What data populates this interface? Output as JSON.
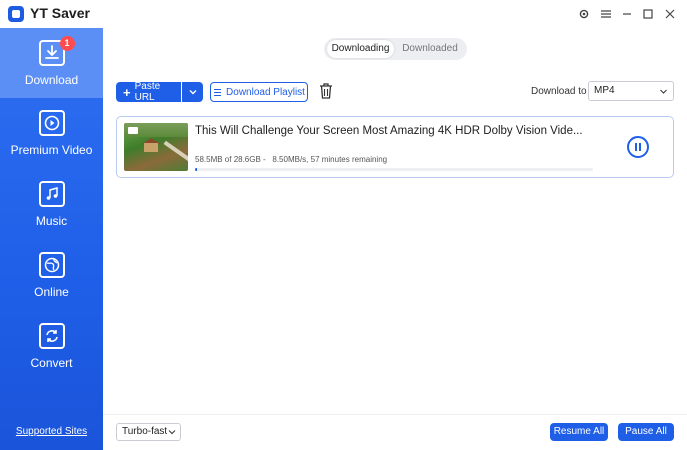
{
  "app": {
    "title": "YT Saver"
  },
  "window": {
    "icons": [
      "gear-icon",
      "menu-icon",
      "minimize-icon",
      "maximize-icon",
      "close-icon"
    ]
  },
  "sidebar": {
    "items": [
      {
        "label": "Download",
        "icon": "download-icon",
        "badge": "1",
        "active": true
      },
      {
        "label": "Premium Video",
        "icon": "play-icon"
      },
      {
        "label": "Music",
        "icon": "music-icon"
      },
      {
        "label": "Online",
        "icon": "globe-icon"
      },
      {
        "label": "Convert",
        "icon": "convert-icon"
      }
    ],
    "supported_sites": "Supported Sites"
  },
  "tabs": {
    "downloading": "Downloading",
    "downloaded": "Downloaded",
    "active": "downloading"
  },
  "toolbar": {
    "paste_url": "Paste URL",
    "download_playlist": "Download Playlist",
    "download_to_label": "Download to",
    "format": "MP4"
  },
  "download_item": {
    "title": "This Will Challenge Your Screen Most Amazing 4K HDR Dolby Vision Vide...",
    "size_progress": "58.5MB of 28.6GB -",
    "speed_remaining": "8.50MB/s, 57 minutes remaining",
    "progress_fraction": 0.002
  },
  "footer": {
    "speed_mode": "Turbo-fast",
    "resume_all": "Resume All",
    "pause_all": "Pause All"
  },
  "colors": {
    "accent": "#1f5fe8",
    "sidebar_active": "#5c8ff5",
    "badge": "#ff4d4f"
  }
}
